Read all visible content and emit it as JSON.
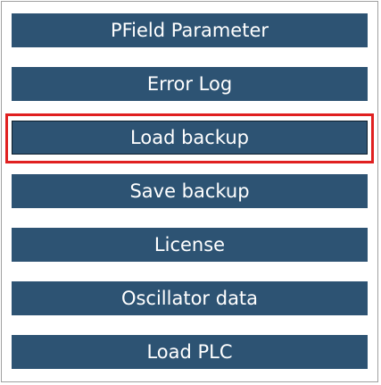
{
  "menu": {
    "accent_color": "#2d5373",
    "selection_color": "#e02020",
    "selected_index": 2,
    "items": [
      {
        "label": "PField Parameter"
      },
      {
        "label": "Error Log"
      },
      {
        "label": "Load backup"
      },
      {
        "label": "Save backup"
      },
      {
        "label": "License"
      },
      {
        "label": "Oscillator data"
      },
      {
        "label": "Load PLC"
      }
    ]
  }
}
